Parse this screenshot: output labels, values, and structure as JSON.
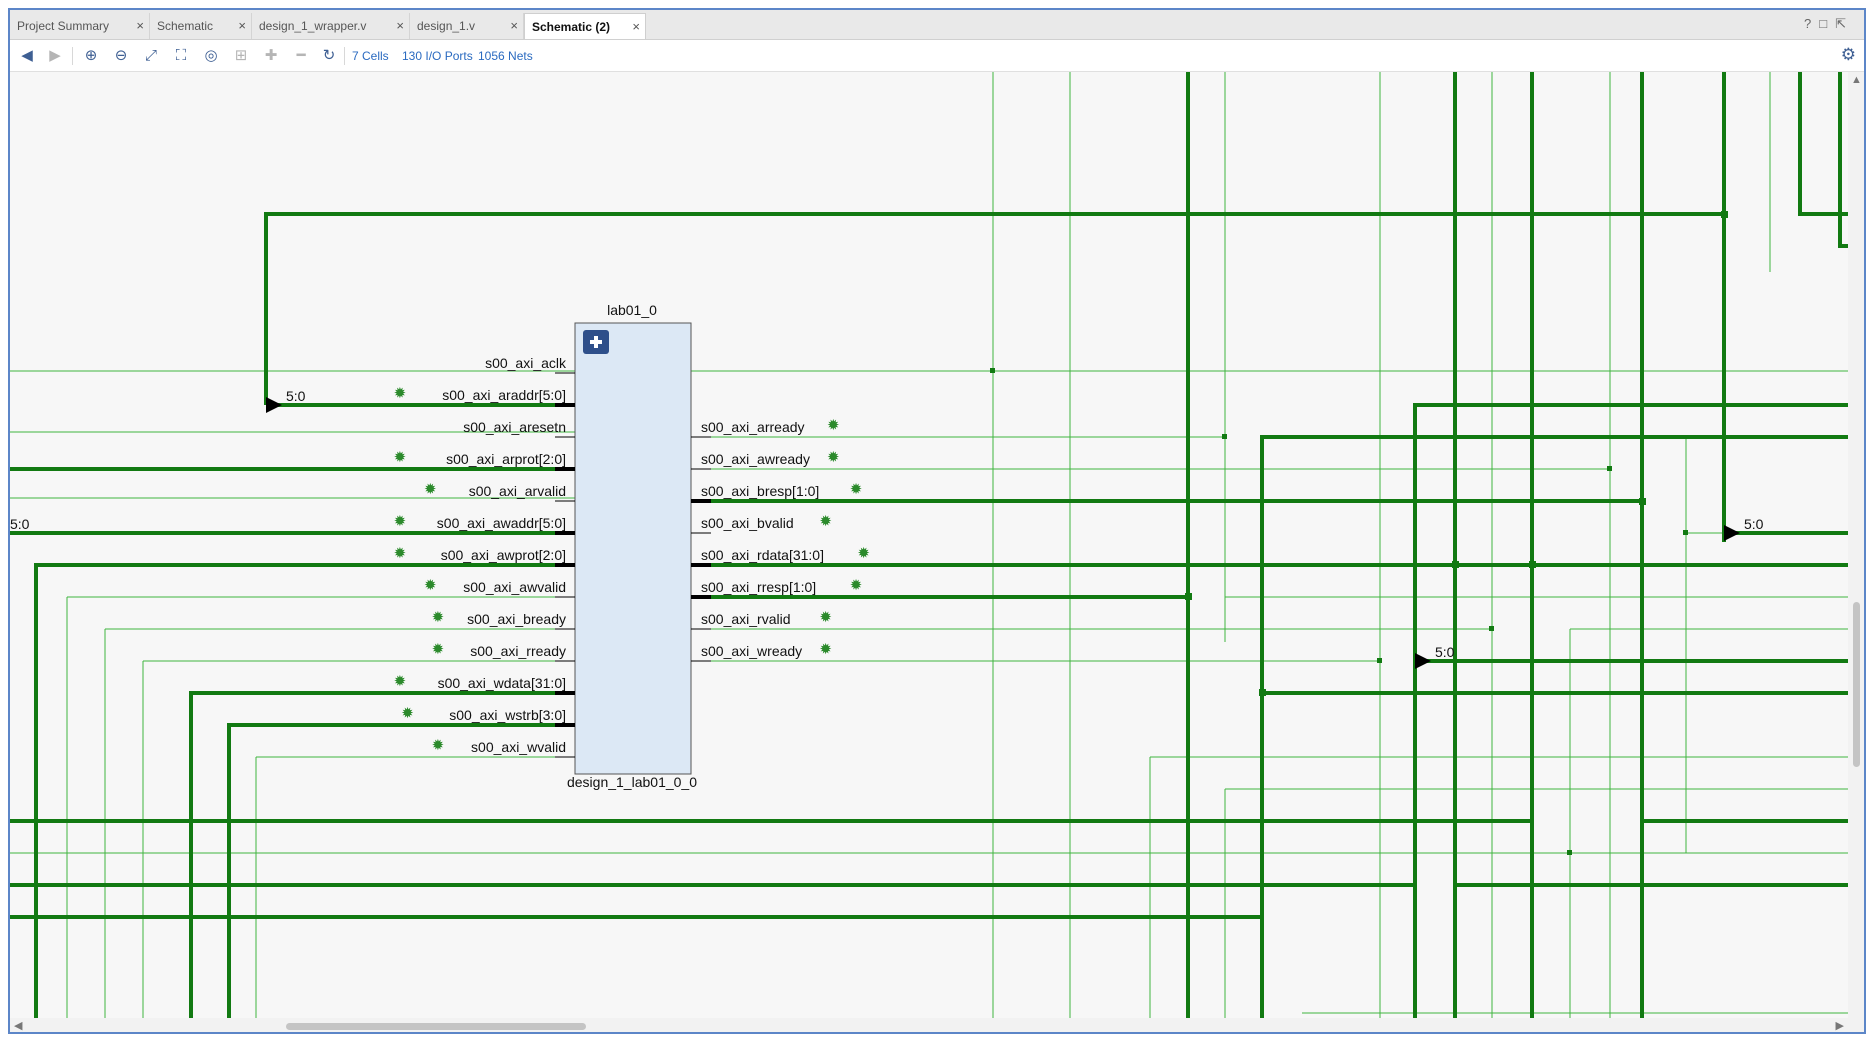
{
  "tabs": [
    {
      "label": "Project Summary",
      "active": false
    },
    {
      "label": "Schematic",
      "active": false
    },
    {
      "label": "design_1_wrapper.v",
      "active": false
    },
    {
      "label": "design_1.v",
      "active": false
    },
    {
      "label": "Schematic (2)",
      "active": true
    }
  ],
  "window_controls": [
    "?",
    "□",
    "⇱"
  ],
  "toolbar": {
    "cells_link": "7 Cells",
    "io_ports_link": "130 I/O Ports",
    "nets_link": "1056 Nets"
  },
  "colors": {
    "wire": "#127a12",
    "wire_thin": "#3fb43f",
    "cell_fill": "#dce8f5",
    "accent": "#3e5f93"
  },
  "block": {
    "instance_name": "lab01_0",
    "cell_name": "design_1_lab01_0_0",
    "inputs": [
      {
        "name": "s00_axi_aclk",
        "debug": false
      },
      {
        "name": "s00_axi_araddr[5:0]",
        "debug": true
      },
      {
        "name": "s00_axi_aresetn",
        "debug": false
      },
      {
        "name": "s00_axi_arprot[2:0]",
        "debug": true
      },
      {
        "name": "s00_axi_arvalid",
        "debug": true
      },
      {
        "name": "s00_axi_awaddr[5:0]",
        "debug": true
      },
      {
        "name": "s00_axi_awprot[2:0]",
        "debug": true
      },
      {
        "name": "s00_axi_awvalid",
        "debug": true
      },
      {
        "name": "s00_axi_bready",
        "debug": true
      },
      {
        "name": "s00_axi_rready",
        "debug": true
      },
      {
        "name": "s00_axi_wdata[31:0]",
        "debug": true
      },
      {
        "name": "s00_axi_wstrb[3:0]",
        "debug": true
      },
      {
        "name": "s00_axi_wvalid",
        "debug": true
      }
    ],
    "outputs": [
      {
        "name": "s00_axi_arready",
        "debug": true
      },
      {
        "name": "s00_axi_awready",
        "debug": true
      },
      {
        "name": "s00_axi_bresp[1:0]",
        "debug": true
      },
      {
        "name": "s00_axi_bvalid",
        "debug": true
      },
      {
        "name": "s00_axi_rdata[31:0]",
        "debug": true
      },
      {
        "name": "s00_axi_rresp[1:0]",
        "debug": true
      },
      {
        "name": "s00_axi_rvalid",
        "debug": true
      },
      {
        "name": "s00_axi_wready",
        "debug": true
      }
    ]
  },
  "bus_labels": {
    "araddr": "5:0",
    "awaddr": "5:0",
    "right_top": "5:0",
    "right_mid": "5:0"
  }
}
